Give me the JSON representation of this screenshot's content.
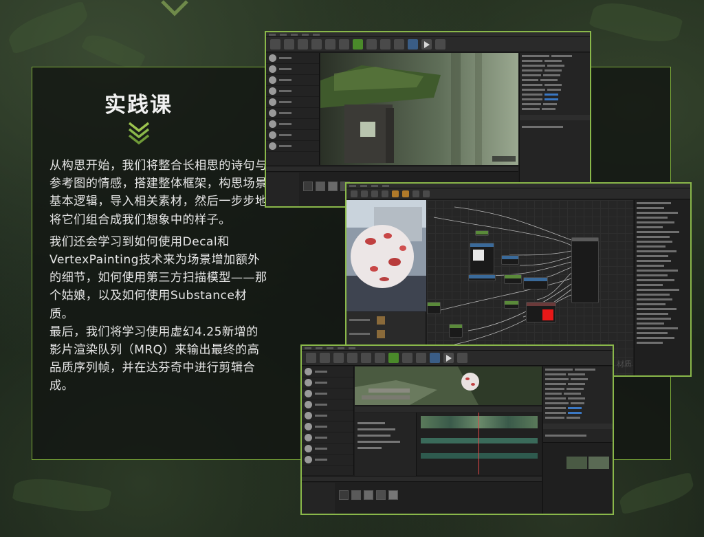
{
  "panel": {
    "title": "实践课",
    "paragraphs": [
      "从构思开始，我们将整合长相思的诗句与参考图的情感，搭建整体框架，构思场景基本逻辑，导入相关素材，然后一步步地将它们组合成我们想象中的样子。",
      "我们还会学习到如何使用Decal和VertexPainting技术来为场景增加额外的细节，如何使用第三方扫描模型——那个姑娘，以及如何使用Substance材质。",
      "最后，我们将学习使用虚幻4.25新增的影片渲染队列（MRQ）来输出最终的高品质序列帧，并在达芬奇中进行剪辑合成。"
    ]
  },
  "material_editor": {
    "watermark": "材质"
  },
  "colors": {
    "accent": "#7fae3a",
    "text": "#e6e6e6",
    "title": "#f2f2f2"
  },
  "icons": [
    "chevron-down-icon",
    "play-icon",
    "sphere-icon"
  ]
}
